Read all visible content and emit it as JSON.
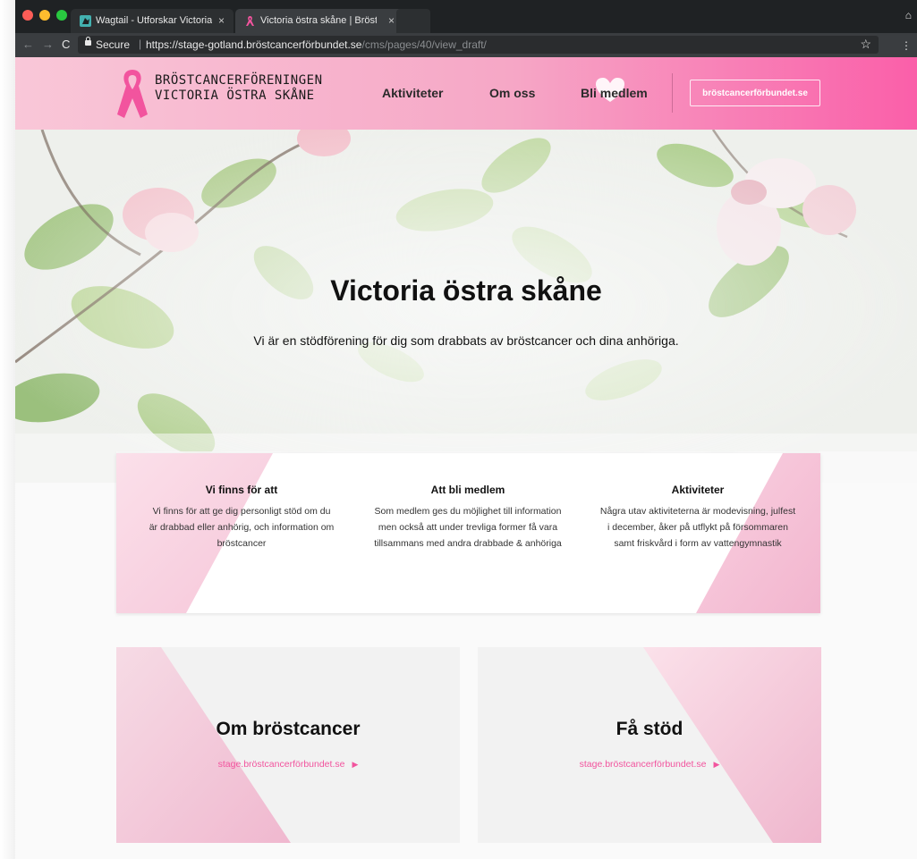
{
  "browser": {
    "tabs": [
      {
        "title": "Wagtail - Utforskar Victoria öst",
        "close": "×"
      },
      {
        "title": "Victoria östra skåne | Bröstcan",
        "close": "×"
      }
    ],
    "secure_label": "Secure",
    "url_host": "https://stage-gotland.bröstcancerförbundet.se",
    "url_path": "/cms/pages/40/view_draft/"
  },
  "header": {
    "brand_line1": "BRÖSTCANCERFÖRENINGEN",
    "brand_line2": "VICTORIA ÖSTRA SKÅNE",
    "nav": [
      "Aktiviteter",
      "Om oss",
      "Bli medlem"
    ],
    "external_button": "bröstcancerförbundet.se"
  },
  "hero": {
    "title": "Victoria östra skåne",
    "subtitle": "Vi är en stödförening för dig som drabbats av bröstcancer och dina anhöriga."
  },
  "info": [
    {
      "title": "Vi finns för att",
      "text": "Vi finns för att ge dig personligt stöd om du är drabbad eller anhörig, och information om bröstcancer"
    },
    {
      "title": "Att bli medlem",
      "text": "Som medlem ges du möjlighet till information men också att under trevliga former få vara tillsammans med andra drabbade & anhöriga"
    },
    {
      "title": "Aktiviteter",
      "text": "Några utav aktiviteterna är modevisning, julfest i december, åker på utflykt på försommaren samt friskvård i form av vattengymnastik"
    }
  ],
  "cards": [
    {
      "title": "Om bröstcancer",
      "link": "stage.bröstcancerförbundet.se"
    },
    {
      "title": "Få stöd",
      "link": "stage.bröstcancerförbundet.se"
    }
  ],
  "colors": {
    "accent": "#f2549e",
    "header_light": "#f9c7d8",
    "header_dark": "#fa5fa9"
  }
}
